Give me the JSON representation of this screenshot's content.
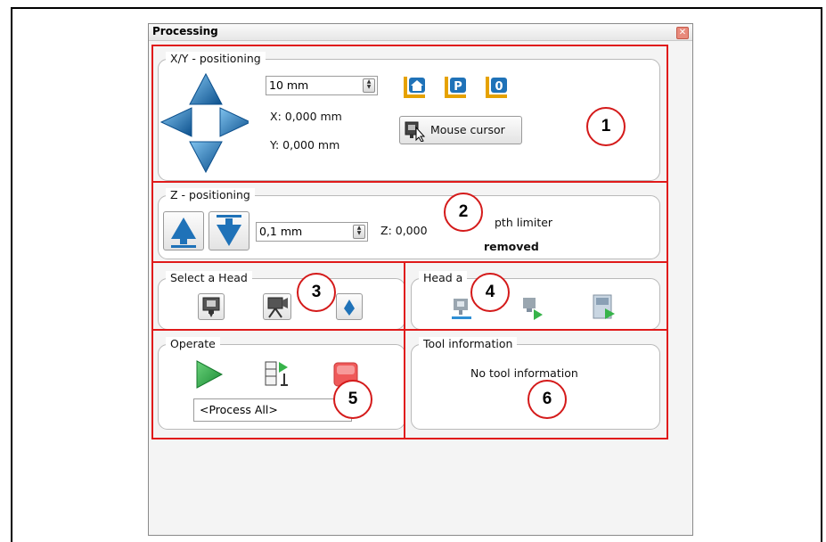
{
  "window": {
    "title": "Processing",
    "close_icon": "close-icon"
  },
  "xy": {
    "label": "X/Y - positioning",
    "step_value": "10 mm",
    "x_readout": "X:  0,000 mm",
    "y_readout": "Y:  0,000 mm",
    "mouse_cursor_label": "Mouse cursor",
    "icons": [
      "home-icon",
      "park-icon",
      "zero-icon"
    ]
  },
  "z": {
    "label": "Z - positioning",
    "step_value": "0,1 mm",
    "z_readout": "Z:  0,000",
    "depth_limiter_label": "pth limiter",
    "depth_limiter_status": "removed"
  },
  "select_head": {
    "label": "Select a Head"
  },
  "head_actions": {
    "label": "Head a"
  },
  "operate": {
    "label": "Operate",
    "process_selection": "<Process All>"
  },
  "tool_info": {
    "label": "Tool information",
    "text": "No tool information"
  },
  "callouts": [
    "1",
    "2",
    "3",
    "4",
    "5",
    "6"
  ],
  "colors": {
    "accent_blue": "#1f72b8",
    "play_green": "#2da84a",
    "stop_red": "#e54545",
    "callout_red": "#e01a1a"
  }
}
